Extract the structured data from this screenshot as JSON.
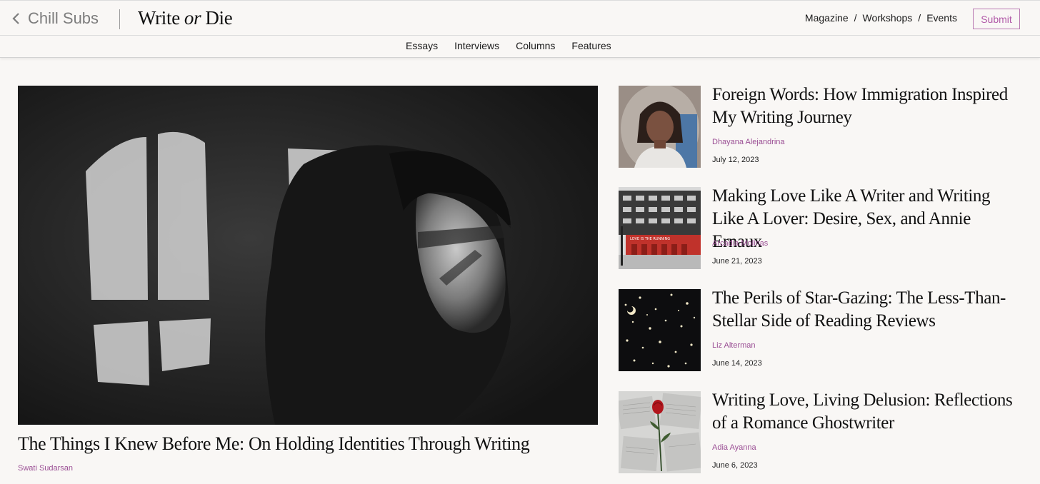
{
  "header": {
    "back_label": "Chill Subs",
    "logo_first": "Write",
    "logo_middle": "or",
    "logo_last": "Die",
    "nav": [
      "Magazine",
      "Workshops",
      "Events"
    ],
    "separator": "/",
    "submit_label": "Submit",
    "accent_color": "#b15aa8"
  },
  "subnav": [
    "Essays",
    "Interviews",
    "Columns",
    "Features"
  ],
  "hero": {
    "title": "The Things I Knew Before Me: On Holding Identities Through Writing",
    "author": "Swati Sudarsan",
    "image": "woman-portrait-window-shadow-bw"
  },
  "articles": [
    {
      "title": "Foreign Words: How Immigration Inspired My Writing Journey",
      "author": "Dhayana Alejandrina",
      "date": "July 12, 2023",
      "image": "childhood-portrait-photo"
    },
    {
      "title": "Making Love Like A Writer and Writing Like A Lover: Desire, Sex, and Annie Ernaux",
      "author": "Arcadia Molinas",
      "date": "June 21, 2023",
      "image": "building-red-mural-street",
      "mural_text": "LOVE IS THE RUNNING"
    },
    {
      "title": "The Perils of Star-Gazing: The Less-Than-Stellar Side of Reading Reviews",
      "author": "Liz Alterman",
      "date": "June 14, 2023",
      "image": "starry-night-sky"
    },
    {
      "title": "Writing Love, Living Delusion: Reflections of a Romance Ghostwriter",
      "author": "Adia Ayanna",
      "date": "June 6, 2023",
      "image": "red-rose-on-pages"
    }
  ]
}
